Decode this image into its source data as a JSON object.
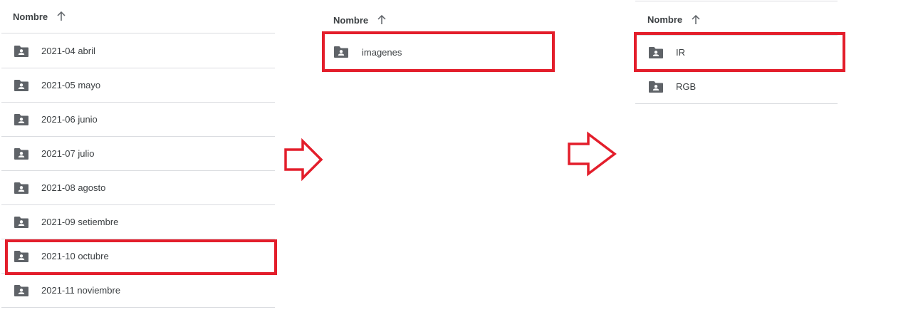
{
  "colors": {
    "highlight": "#e31e2b",
    "folder_icon": "#5f6368",
    "divider": "#dadce0",
    "text": "#3c4043"
  },
  "icons": {
    "sort": "arrow-up-icon",
    "folder": "shared-folder-icon",
    "flow": "right-arrow-icon"
  },
  "panels": [
    {
      "header": {
        "label": "Nombre"
      },
      "items": [
        {
          "label": "2021-04 abril"
        },
        {
          "label": "2021-05 mayo"
        },
        {
          "label": "2021-06 junio"
        },
        {
          "label": "2021-07 julio"
        },
        {
          "label": "2021-08 agosto"
        },
        {
          "label": "2021-09 setiembre"
        },
        {
          "label": "2021-10 octubre",
          "highlighted": true
        },
        {
          "label": "2021-11 noviembre"
        }
      ]
    },
    {
      "header": {
        "label": "Nombre"
      },
      "items": [
        {
          "label": "imagenes",
          "highlighted": true
        }
      ]
    },
    {
      "header": {
        "label": "Nombre"
      },
      "items": [
        {
          "label": "IR",
          "highlighted": true
        },
        {
          "label": "RGB"
        }
      ]
    }
  ]
}
